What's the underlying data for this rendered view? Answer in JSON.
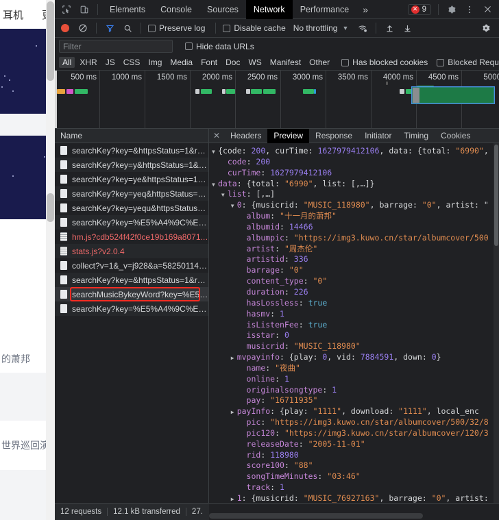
{
  "page_sliver": {
    "nav_left": "耳机",
    "nav_right": "更",
    "text_1": "的萧邦",
    "text_2": "世界巡回演唱"
  },
  "devtools": {
    "main_tabs": [
      {
        "label": "Elements",
        "active": false
      },
      {
        "label": "Console",
        "active": false
      },
      {
        "label": "Sources",
        "active": false
      },
      {
        "label": "Network",
        "active": true
      },
      {
        "label": "Performance",
        "active": false
      }
    ],
    "more_tabs_label": "»",
    "inspect_icon": "inspect-element-icon",
    "device_icon": "toggle-device-toolbar-icon",
    "error_count": "9",
    "error_glyph": "✕",
    "settings_icon": "gear-icon",
    "kebab_icon": "more-options-icon",
    "close_icon": "close-icon",
    "toolbar": {
      "record_title": "record-button",
      "clear_title": "clear-button",
      "filter_title": "filter-icon",
      "search_title": "search-icon",
      "preserve_log": "Preserve log",
      "disable_cache": "Disable cache",
      "throttling": "No throttling",
      "caret": "▼",
      "wifi_icon": "network-conditions-icon",
      "import_icon": "import-har-icon",
      "export_icon": "export-har-icon",
      "settings_icon": "network-settings-gear-icon"
    },
    "filter": {
      "placeholder": "Filter",
      "value": "",
      "hide_data_urls": "Hide data URLs"
    },
    "type_filters": [
      {
        "label": "All",
        "active": true
      },
      {
        "label": "XHR",
        "active": false
      },
      {
        "label": "JS",
        "active": false
      },
      {
        "label": "CSS",
        "active": false
      },
      {
        "label": "Img",
        "active": false
      },
      {
        "label": "Media",
        "active": false
      },
      {
        "label": "Font",
        "active": false
      },
      {
        "label": "Doc",
        "active": false
      },
      {
        "label": "WS",
        "active": false
      },
      {
        "label": "Manifest",
        "active": false
      },
      {
        "label": "Other",
        "active": false
      }
    ],
    "type_checkboxes": [
      {
        "label": "Has blocked cookies"
      },
      {
        "label": "Blocked Requests"
      }
    ],
    "overview": {
      "ticks": [
        "500 ms",
        "1000 ms",
        "1500 ms",
        "2000 ms",
        "2500 ms",
        "3000 ms",
        "3500 ms",
        "4000 ms",
        "4500 ms",
        "5000"
      ]
    },
    "requests": {
      "column_header": "Name",
      "rows": [
        {
          "name": "searchKey?key=&httpsStatus=1&re…",
          "type": "xhr",
          "error": false,
          "selected": false,
          "highlighted": false
        },
        {
          "name": "searchKey?key=y&httpsStatus=1&r…",
          "type": "xhr",
          "error": false,
          "selected": false,
          "highlighted": false
        },
        {
          "name": "searchKey?key=ye&httpsStatus=1&…",
          "type": "xhr",
          "error": false,
          "selected": false,
          "highlighted": false
        },
        {
          "name": "searchKey?key=yeq&httpsStatus=1…",
          "type": "xhr",
          "error": false,
          "selected": false,
          "highlighted": false
        },
        {
          "name": "searchKey?key=yequ&httpsStatus=…",
          "type": "xhr",
          "error": false,
          "selected": false,
          "highlighted": false
        },
        {
          "name": "searchKey?key=%E5%A4%9C%E6%…",
          "type": "xhr",
          "error": false,
          "selected": false,
          "highlighted": false
        },
        {
          "name": "hm.js?cdb524f42f0ce19b169a80711…",
          "type": "js",
          "error": true,
          "selected": false,
          "highlighted": false
        },
        {
          "name": "stats.js?v2.0.4",
          "type": "js",
          "error": true,
          "selected": false,
          "highlighted": false
        },
        {
          "name": "collect?v=1&_v=j928&a=582501144…",
          "type": "xhr",
          "error": false,
          "selected": false,
          "highlighted": false
        },
        {
          "name": "searchKey?key=&httpsStatus=1&re…",
          "type": "xhr",
          "error": false,
          "selected": false,
          "highlighted": false
        },
        {
          "name": "searchMusicBykeyWord?key=%E5%…",
          "type": "xhr",
          "error": false,
          "selected": true,
          "highlighted": true
        },
        {
          "name": "searchKey?key=%E5%A4%9C%E6%…",
          "type": "xhr",
          "error": false,
          "selected": false,
          "highlighted": false
        }
      ]
    },
    "detail_tabs": [
      {
        "label": "Headers",
        "active": false
      },
      {
        "label": "Preview",
        "active": true
      },
      {
        "label": "Response",
        "active": false
      },
      {
        "label": "Initiator",
        "active": false
      },
      {
        "label": "Timing",
        "active": false
      },
      {
        "label": "Cookies",
        "active": false
      }
    ],
    "detail_close": "✕",
    "preview_lines": [
      {
        "indent": 0,
        "tri": "open",
        "parts": [
          {
            "t": "p",
            "v": "{"
          },
          {
            "t": "kn",
            "v": "code"
          },
          {
            "t": "p",
            "v": ": "
          },
          {
            "t": "n",
            "v": "200"
          },
          {
            "t": "p",
            "v": ", "
          },
          {
            "t": "kn",
            "v": "curTime"
          },
          {
            "t": "p",
            "v": ": "
          },
          {
            "t": "n",
            "v": "1627979412106"
          },
          {
            "t": "p",
            "v": ", "
          },
          {
            "t": "kn",
            "v": "data"
          },
          {
            "t": "p",
            "v": ": {"
          },
          {
            "t": "kn",
            "v": "total"
          },
          {
            "t": "p",
            "v": ": "
          },
          {
            "t": "s",
            "v": "\"6990\""
          },
          {
            "t": "p",
            "v": ", l"
          }
        ]
      },
      {
        "indent": 1,
        "tri": "blank",
        "parts": [
          {
            "t": "k",
            "v": "code"
          },
          {
            "t": "p",
            "v": ": "
          },
          {
            "t": "n",
            "v": "200"
          }
        ]
      },
      {
        "indent": 1,
        "tri": "blank",
        "parts": [
          {
            "t": "k",
            "v": "curTime"
          },
          {
            "t": "p",
            "v": ": "
          },
          {
            "t": "n",
            "v": "1627979412106"
          }
        ]
      },
      {
        "indent": 0,
        "tri": "open",
        "parts": [
          {
            "t": "k",
            "v": "data"
          },
          {
            "t": "p",
            "v": ": {"
          },
          {
            "t": "kn",
            "v": "total"
          },
          {
            "t": "p",
            "v": ": "
          },
          {
            "t": "s",
            "v": "\"6990\""
          },
          {
            "t": "p",
            "v": ", "
          },
          {
            "t": "kn",
            "v": "list"
          },
          {
            "t": "p",
            "v": ": [,…]}"
          }
        ]
      },
      {
        "indent": 1,
        "tri": "open",
        "parts": [
          {
            "t": "k",
            "v": "list"
          },
          {
            "t": "p",
            "v": ": [,…]"
          }
        ]
      },
      {
        "indent": 2,
        "tri": "open",
        "parts": [
          {
            "t": "k",
            "v": "0"
          },
          {
            "t": "p",
            "v": ": {"
          },
          {
            "t": "kn",
            "v": "musicrid"
          },
          {
            "t": "p",
            "v": ": "
          },
          {
            "t": "s",
            "v": "\"MUSIC_118980\""
          },
          {
            "t": "p",
            "v": ", "
          },
          {
            "t": "kn",
            "v": "barrage"
          },
          {
            "t": "p",
            "v": ": "
          },
          {
            "t": "s",
            "v": "\"0\""
          },
          {
            "t": "p",
            "v": ", "
          },
          {
            "t": "kn",
            "v": "artist"
          },
          {
            "t": "p",
            "v": ": \""
          }
        ]
      },
      {
        "indent": 3,
        "tri": "blank",
        "parts": [
          {
            "t": "k",
            "v": "album"
          },
          {
            "t": "p",
            "v": ": "
          },
          {
            "t": "s",
            "v": "\"十一月的萧邦\""
          }
        ]
      },
      {
        "indent": 3,
        "tri": "blank",
        "parts": [
          {
            "t": "k",
            "v": "albumid"
          },
          {
            "t": "p",
            "v": ": "
          },
          {
            "t": "n",
            "v": "14466"
          }
        ]
      },
      {
        "indent": 3,
        "tri": "blank",
        "parts": [
          {
            "t": "k",
            "v": "albumpic"
          },
          {
            "t": "p",
            "v": ": "
          },
          {
            "t": "s",
            "v": "\"https://img3.kuwo.cn/star/albumcover/500"
          }
        ]
      },
      {
        "indent": 3,
        "tri": "blank",
        "parts": [
          {
            "t": "k",
            "v": "artist"
          },
          {
            "t": "p",
            "v": ": "
          },
          {
            "t": "s",
            "v": "\"周杰伦\""
          }
        ]
      },
      {
        "indent": 3,
        "tri": "blank",
        "parts": [
          {
            "t": "k",
            "v": "artistid"
          },
          {
            "t": "p",
            "v": ": "
          },
          {
            "t": "n",
            "v": "336"
          }
        ]
      },
      {
        "indent": 3,
        "tri": "blank",
        "parts": [
          {
            "t": "k",
            "v": "barrage"
          },
          {
            "t": "p",
            "v": ": "
          },
          {
            "t": "s",
            "v": "\"0\""
          }
        ]
      },
      {
        "indent": 3,
        "tri": "blank",
        "parts": [
          {
            "t": "k",
            "v": "content_type"
          },
          {
            "t": "p",
            "v": ": "
          },
          {
            "t": "s",
            "v": "\"0\""
          }
        ]
      },
      {
        "indent": 3,
        "tri": "blank",
        "parts": [
          {
            "t": "k",
            "v": "duration"
          },
          {
            "t": "p",
            "v": ": "
          },
          {
            "t": "n",
            "v": "226"
          }
        ]
      },
      {
        "indent": 3,
        "tri": "blank",
        "parts": [
          {
            "t": "k",
            "v": "hasLossless"
          },
          {
            "t": "p",
            "v": ": "
          },
          {
            "t": "b",
            "v": "true"
          }
        ]
      },
      {
        "indent": 3,
        "tri": "blank",
        "parts": [
          {
            "t": "k",
            "v": "hasmv"
          },
          {
            "t": "p",
            "v": ": "
          },
          {
            "t": "n",
            "v": "1"
          }
        ]
      },
      {
        "indent": 3,
        "tri": "blank",
        "parts": [
          {
            "t": "k",
            "v": "isListenFee"
          },
          {
            "t": "p",
            "v": ": "
          },
          {
            "t": "b",
            "v": "true"
          }
        ]
      },
      {
        "indent": 3,
        "tri": "blank",
        "parts": [
          {
            "t": "k",
            "v": "isstar"
          },
          {
            "t": "p",
            "v": ": "
          },
          {
            "t": "n",
            "v": "0"
          }
        ]
      },
      {
        "indent": 3,
        "tri": "blank",
        "parts": [
          {
            "t": "k",
            "v": "musicrid"
          },
          {
            "t": "p",
            "v": ": "
          },
          {
            "t": "s",
            "v": "\"MUSIC_118980\""
          }
        ]
      },
      {
        "indent": 2,
        "tri": "closed",
        "parts": [
          {
            "t": "k",
            "v": "mvpayinfo"
          },
          {
            "t": "p",
            "v": ": {"
          },
          {
            "t": "kn",
            "v": "play"
          },
          {
            "t": "p",
            "v": ": "
          },
          {
            "t": "n",
            "v": "0"
          },
          {
            "t": "p",
            "v": ", "
          },
          {
            "t": "kn",
            "v": "vid"
          },
          {
            "t": "p",
            "v": ": "
          },
          {
            "t": "n",
            "v": "7884591"
          },
          {
            "t": "p",
            "v": ", "
          },
          {
            "t": "kn",
            "v": "down"
          },
          {
            "t": "p",
            "v": ": "
          },
          {
            "t": "n",
            "v": "0"
          },
          {
            "t": "p",
            "v": "}"
          }
        ]
      },
      {
        "indent": 3,
        "tri": "blank",
        "parts": [
          {
            "t": "k",
            "v": "name"
          },
          {
            "t": "p",
            "v": ": "
          },
          {
            "t": "s",
            "v": "\"夜曲\""
          }
        ]
      },
      {
        "indent": 3,
        "tri": "blank",
        "parts": [
          {
            "t": "k",
            "v": "online"
          },
          {
            "t": "p",
            "v": ": "
          },
          {
            "t": "n",
            "v": "1"
          }
        ]
      },
      {
        "indent": 3,
        "tri": "blank",
        "parts": [
          {
            "t": "k",
            "v": "originalsongtype"
          },
          {
            "t": "p",
            "v": ": "
          },
          {
            "t": "n",
            "v": "1"
          }
        ]
      },
      {
        "indent": 3,
        "tri": "blank",
        "parts": [
          {
            "t": "k",
            "v": "pay"
          },
          {
            "t": "p",
            "v": ": "
          },
          {
            "t": "s",
            "v": "\"16711935\""
          }
        ]
      },
      {
        "indent": 2,
        "tri": "closed",
        "parts": [
          {
            "t": "k",
            "v": "payInfo"
          },
          {
            "t": "p",
            "v": ": {"
          },
          {
            "t": "kn",
            "v": "play"
          },
          {
            "t": "p",
            "v": ": "
          },
          {
            "t": "s",
            "v": "\"1111\""
          },
          {
            "t": "p",
            "v": ", "
          },
          {
            "t": "kn",
            "v": "download"
          },
          {
            "t": "p",
            "v": ": "
          },
          {
            "t": "s",
            "v": "\"1111\""
          },
          {
            "t": "p",
            "v": ", "
          },
          {
            "t": "kn",
            "v": "local_enc"
          }
        ]
      },
      {
        "indent": 3,
        "tri": "blank",
        "parts": [
          {
            "t": "k",
            "v": "pic"
          },
          {
            "t": "p",
            "v": ": "
          },
          {
            "t": "s",
            "v": "\"https://img3.kuwo.cn/star/albumcover/500/32/8"
          }
        ]
      },
      {
        "indent": 3,
        "tri": "blank",
        "parts": [
          {
            "t": "k",
            "v": "pic120"
          },
          {
            "t": "p",
            "v": ": "
          },
          {
            "t": "s",
            "v": "\"https://img3.kuwo.cn/star/albumcover/120/3"
          }
        ]
      },
      {
        "indent": 3,
        "tri": "blank",
        "parts": [
          {
            "t": "k",
            "v": "releaseDate"
          },
          {
            "t": "p",
            "v": ": "
          },
          {
            "t": "s",
            "v": "\"2005-11-01\""
          }
        ]
      },
      {
        "indent": 3,
        "tri": "blank",
        "parts": [
          {
            "t": "k",
            "v": "rid"
          },
          {
            "t": "p",
            "v": ": "
          },
          {
            "t": "n",
            "v": "118980"
          }
        ]
      },
      {
        "indent": 3,
        "tri": "blank",
        "parts": [
          {
            "t": "k",
            "v": "score100"
          },
          {
            "t": "p",
            "v": ": "
          },
          {
            "t": "s",
            "v": "\"88\""
          }
        ]
      },
      {
        "indent": 3,
        "tri": "blank",
        "parts": [
          {
            "t": "k",
            "v": "songTimeMinutes"
          },
          {
            "t": "p",
            "v": ": "
          },
          {
            "t": "s",
            "v": "\"03:46\""
          }
        ]
      },
      {
        "indent": 3,
        "tri": "blank",
        "parts": [
          {
            "t": "k",
            "v": "track"
          },
          {
            "t": "p",
            "v": ": "
          },
          {
            "t": "n",
            "v": "1"
          }
        ]
      },
      {
        "indent": 2,
        "tri": "closed",
        "parts": [
          {
            "t": "k",
            "v": "1"
          },
          {
            "t": "p",
            "v": ": {"
          },
          {
            "t": "kn",
            "v": "musicrid"
          },
          {
            "t": "p",
            "v": ": "
          },
          {
            "t": "s",
            "v": "\"MUSIC_76927163\""
          },
          {
            "t": "p",
            "v": ", "
          },
          {
            "t": "kn",
            "v": "barrage"
          },
          {
            "t": "p",
            "v": ": "
          },
          {
            "t": "s",
            "v": "\"0\""
          },
          {
            "t": "p",
            "v": ", "
          },
          {
            "t": "kn",
            "v": "artist"
          },
          {
            "t": "p",
            "v": ":"
          }
        ]
      }
    ],
    "status": {
      "requests": "12 requests",
      "transferred": "12.1 kB transferred",
      "resources": "27."
    }
  },
  "colors": {
    "accent_red": "#f42b22",
    "error_red": "#f16a6a",
    "green_bar": "#4aa96c",
    "selection_blue": "#4a90e2",
    "string_orange": "#e08c50",
    "key_purple": "#c586d8",
    "number_violet": "#9a7ff0"
  }
}
